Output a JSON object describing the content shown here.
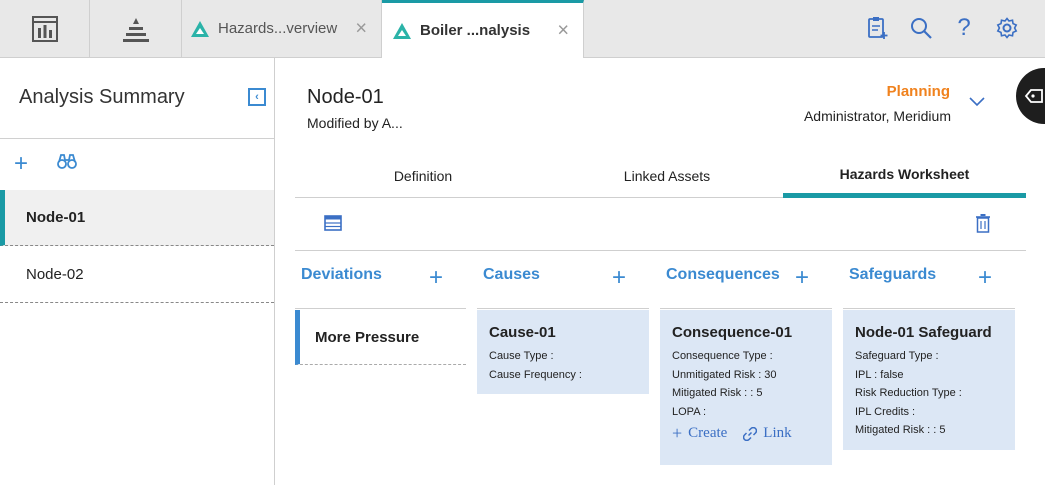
{
  "topbar": {
    "tabs": [
      {
        "label": "Hazards...verview",
        "close": "×"
      },
      {
        "label": "Boiler ...nalysis",
        "close": "×"
      }
    ],
    "icons": [
      "dashboard-icon",
      "hierarchy-icon",
      "add-document-icon",
      "search-icon",
      "help-icon",
      "settings-icon"
    ],
    "help_glyph": "?"
  },
  "left_panel": {
    "title": "Analysis Summary",
    "add_glyph": "+",
    "nodes": [
      {
        "label": "Node-01",
        "selected": true
      },
      {
        "label": "Node-02",
        "selected": false
      }
    ]
  },
  "main": {
    "node_title": "Node-01",
    "modified": "Modified by A...",
    "status": "Planning",
    "owner": "Administrator, Meridium",
    "tabs": [
      {
        "label": "Definition"
      },
      {
        "label": "Linked Assets"
      },
      {
        "label": "Hazards Worksheet",
        "active": true
      }
    ],
    "columns": {
      "deviations": "Deviations",
      "causes": "Causes",
      "consequences": "Consequences",
      "safeguards": "Safeguards",
      "add_glyph": "+"
    },
    "deviation": "More Pressure",
    "cause": {
      "title": "Cause-01",
      "lines": [
        "Cause Type :",
        "Cause Frequency :"
      ]
    },
    "consequence": {
      "title": "Consequence-01",
      "lines": [
        "Consequence Type :",
        "Unmitigated Risk : 30",
        "Mitigated Risk : : 5",
        "LOPA :"
      ],
      "create": "Create",
      "link": "Link"
    },
    "safeguard": {
      "title": "Node-01 Safeguard",
      "lines": [
        "Safeguard Type :",
        "IPL : false",
        "Risk Reduction Type :",
        "IPL Credits :",
        "Mitigated Risk : : 5"
      ]
    }
  },
  "colors": {
    "accent": "#1a9aa5",
    "link_blue": "#3b8ad1",
    "status_orange": "#f0821e",
    "card_bg": "#dce7f5"
  }
}
